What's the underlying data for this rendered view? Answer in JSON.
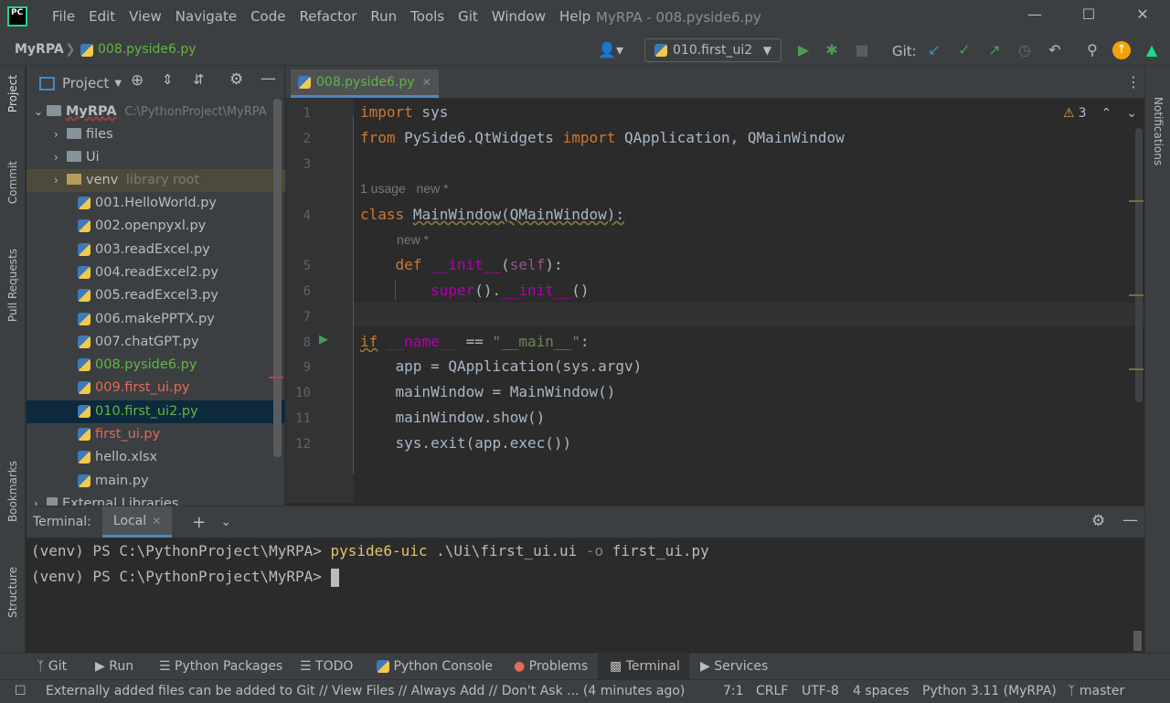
{
  "menu": [
    "File",
    "Edit",
    "View",
    "Navigate",
    "Code",
    "Refactor",
    "Run",
    "Tools",
    "Git",
    "Window",
    "Help"
  ],
  "window_title": "MyRPA - 008.pyside6.py",
  "breadcrumb": {
    "project": "MyRPA",
    "file": "008.pyside6.py"
  },
  "run_config": "010.first_ui2",
  "git_label": "Git:",
  "project_panel": {
    "title": "Project",
    "root": {
      "name": "MyRPA",
      "path": "C:\\PythonProject\\MyRPA"
    },
    "folders": [
      {
        "name": "files"
      },
      {
        "name": "Ui"
      },
      {
        "name": "venv",
        "note": "library root"
      }
    ],
    "files": [
      {
        "name": "001.HelloWorld.py",
        "color": "#bbbbbb"
      },
      {
        "name": "002.openpyxl.py",
        "color": "#bbbbbb"
      },
      {
        "name": "003.readExcel.py",
        "color": "#bbbbbb"
      },
      {
        "name": "004.readExcel2.py",
        "color": "#bbbbbb"
      },
      {
        "name": "005.readExcel3.py",
        "color": "#bbbbbb"
      },
      {
        "name": "006.makePPTX.py",
        "color": "#bbbbbb"
      },
      {
        "name": "007.chatGPT.py",
        "color": "#bbbbbb"
      },
      {
        "name": "008.pyside6.py",
        "color": "#62b543"
      },
      {
        "name": "009.first_ui.py",
        "color": "#e06c57"
      },
      {
        "name": "010.first_ui2.py",
        "color": "#62b543"
      },
      {
        "name": "first_ui.py",
        "color": "#e06c57"
      },
      {
        "name": "hello.xlsx",
        "color": "#bbbbbb"
      },
      {
        "name": "main.py",
        "color": "#bbbbbb"
      }
    ],
    "external": "External Libraries"
  },
  "editor": {
    "tab": "008.pyside6.py",
    "warnings": "3",
    "hint_usage": "1 usage",
    "hint_new": "new *",
    "line_numbers": [
      "1",
      "2",
      "3",
      "4",
      "5",
      "6",
      "7",
      "8",
      "9",
      "10",
      "11",
      "12"
    ]
  },
  "side_tabs": {
    "left": [
      "Project",
      "Commit",
      "Pull Requests",
      "Bookmarks",
      "Structure"
    ],
    "right": [
      "Notifications"
    ]
  },
  "terminal": {
    "label": "Terminal:",
    "tab": "Local",
    "line1_prompt": "(venv) PS C:\\PythonProject\\MyRPA> ",
    "line1_cmd": "pyside6-uic",
    "line1_args": " .\\Ui\\first_ui.ui ",
    "line1_flag": "-o",
    "line1_out": " first_ui.py",
    "line2_prompt": "(venv) PS C:\\PythonProject\\MyRPA> "
  },
  "tool_windows": [
    "Git",
    "Run",
    "Python Packages",
    "TODO",
    "Python Console",
    "Problems",
    "Terminal",
    "Services"
  ],
  "status": {
    "message": "Externally added files can be added to Git // View Files // Always Add // Don't Ask ... (4 minutes ago)",
    "position": "7:1",
    "line_sep": "CRLF",
    "encoding": "UTF-8",
    "indent": "4 spaces",
    "interpreter": "Python 3.11 (MyRPA)",
    "branch": "master"
  }
}
